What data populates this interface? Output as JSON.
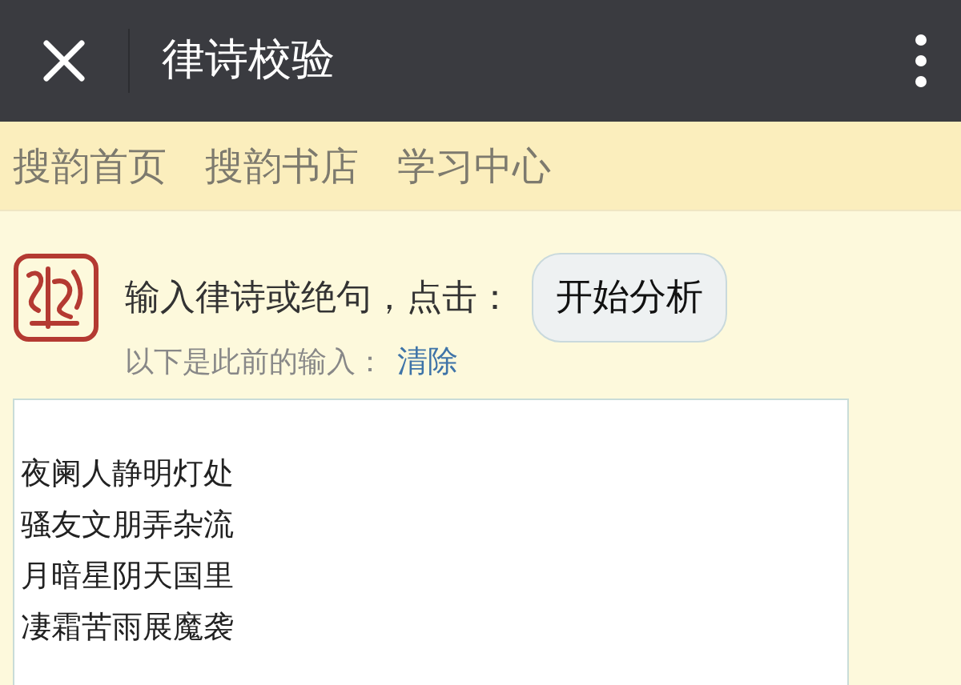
{
  "top_bar": {
    "title": "律诗校验"
  },
  "nav": [
    {
      "label": "搜韵首页"
    },
    {
      "label": "搜韵书店"
    },
    {
      "label": "学习中心"
    }
  ],
  "prompt": {
    "text": "输入律诗或绝句，点击：",
    "button": "开始分析"
  },
  "history": {
    "text": "以下是此前的输入：",
    "link": "清除"
  },
  "poem_input": {
    "lines": [
      "夜阑人静明灯处",
      "骚友文朋弄杂流",
      "月暗星阴天国里",
      "凄霜苦雨展魔袭"
    ]
  }
}
